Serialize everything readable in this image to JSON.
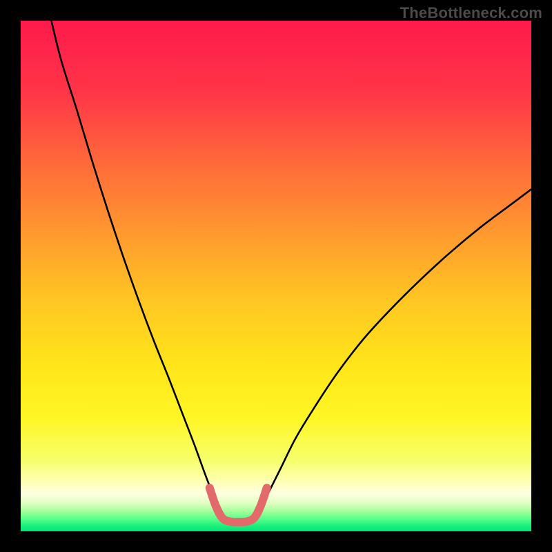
{
  "watermark": "TheBottleneck.com",
  "chart_data": {
    "type": "line",
    "title": "",
    "xlabel": "",
    "ylabel": "",
    "xlim": [
      0,
      100
    ],
    "ylim": [
      0,
      100
    ],
    "grid": false,
    "gradient_stops": [
      {
        "offset": 0.0,
        "color": "#ff1a4b"
      },
      {
        "offset": 0.14,
        "color": "#ff3548"
      },
      {
        "offset": 0.28,
        "color": "#ff6a3a"
      },
      {
        "offset": 0.42,
        "color": "#ff9a2e"
      },
      {
        "offset": 0.55,
        "color": "#ffc722"
      },
      {
        "offset": 0.68,
        "color": "#ffe61a"
      },
      {
        "offset": 0.78,
        "color": "#fff626"
      },
      {
        "offset": 0.86,
        "color": "#f6ff6a"
      },
      {
        "offset": 0.9,
        "color": "#ffffb0"
      },
      {
        "offset": 0.925,
        "color": "#ffffe0"
      },
      {
        "offset": 0.945,
        "color": "#e0ffc0"
      },
      {
        "offset": 0.96,
        "color": "#a6ff9c"
      },
      {
        "offset": 0.975,
        "color": "#5bff8a"
      },
      {
        "offset": 0.99,
        "color": "#18f07a"
      },
      {
        "offset": 1.0,
        "color": "#00e676"
      }
    ],
    "series": [
      {
        "name": "left-branch",
        "color": "#000000",
        "stroke_width": 2.6,
        "points": [
          {
            "x": 6.0,
            "y": 100.0
          },
          {
            "x": 8.0,
            "y": 92.0
          },
          {
            "x": 11.0,
            "y": 82.5
          },
          {
            "x": 14.0,
            "y": 72.5
          },
          {
            "x": 17.0,
            "y": 63.0
          },
          {
            "x": 20.0,
            "y": 54.0
          },
          {
            "x": 23.0,
            "y": 45.5
          },
          {
            "x": 26.0,
            "y": 37.5
          },
          {
            "x": 29.0,
            "y": 30.0
          },
          {
            "x": 31.5,
            "y": 23.5
          },
          {
            "x": 34.0,
            "y": 17.0
          },
          {
            "x": 36.0,
            "y": 11.5
          },
          {
            "x": 37.5,
            "y": 7.5
          },
          {
            "x": 38.5,
            "y": 4.5
          }
        ]
      },
      {
        "name": "right-branch",
        "color": "#000000",
        "stroke_width": 2.6,
        "points": [
          {
            "x": 47.0,
            "y": 4.5
          },
          {
            "x": 48.5,
            "y": 7.5
          },
          {
            "x": 51.0,
            "y": 12.5
          },
          {
            "x": 54.0,
            "y": 18.5
          },
          {
            "x": 58.0,
            "y": 25.0
          },
          {
            "x": 62.0,
            "y": 31.0
          },
          {
            "x": 67.0,
            "y": 37.5
          },
          {
            "x": 72.0,
            "y": 43.0
          },
          {
            "x": 78.0,
            "y": 49.0
          },
          {
            "x": 84.0,
            "y": 54.5
          },
          {
            "x": 90.0,
            "y": 59.5
          },
          {
            "x": 96.0,
            "y": 64.0
          },
          {
            "x": 100.0,
            "y": 67.0
          }
        ]
      },
      {
        "name": "valley-highlight",
        "color": "#e26a6a",
        "stroke_width": 12,
        "linecap": "round",
        "points": [
          {
            "x": 37.0,
            "y": 8.5
          },
          {
            "x": 38.2,
            "y": 5.0
          },
          {
            "x": 39.5,
            "y": 2.6
          },
          {
            "x": 41.0,
            "y": 1.9
          },
          {
            "x": 42.8,
            "y": 1.8
          },
          {
            "x": 44.3,
            "y": 1.9
          },
          {
            "x": 45.8,
            "y": 2.7
          },
          {
            "x": 47.0,
            "y": 5.0
          },
          {
            "x": 48.2,
            "y": 8.5
          }
        ]
      }
    ]
  }
}
